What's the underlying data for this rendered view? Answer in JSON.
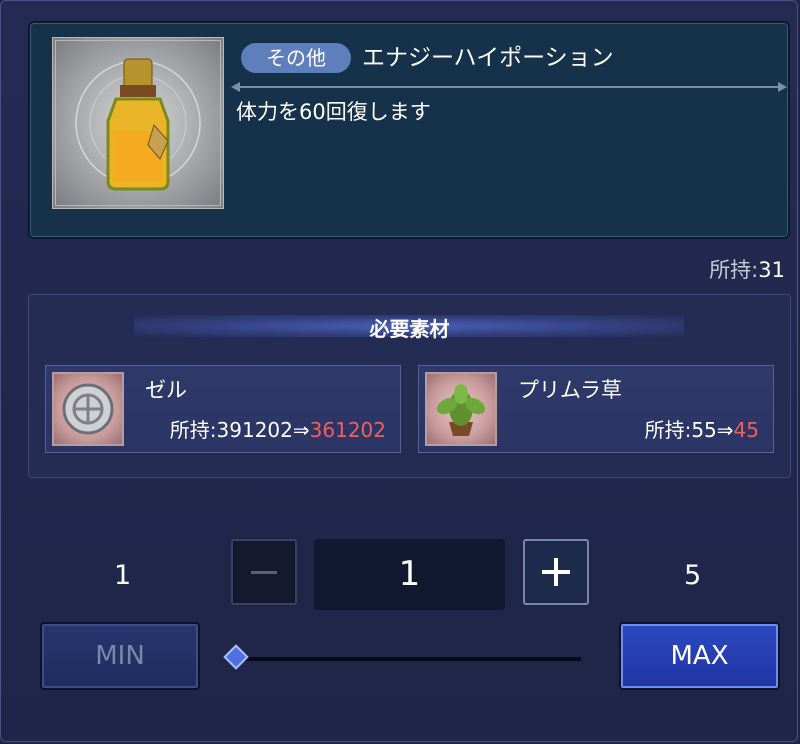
{
  "item": {
    "category": "その他",
    "name": "エナジーハイポーション",
    "description": "体力を60回復します",
    "icon": "potion-bottle-icon"
  },
  "owned": {
    "label": "所持:",
    "value": "31"
  },
  "materials": {
    "title": "必要素材",
    "items": [
      {
        "name": "ゼル",
        "label": "所持:",
        "before": "391202",
        "arrow": "⇒",
        "after": "361202",
        "icon": "zel-coin-icon"
      },
      {
        "name": "プリムラ草",
        "label": "所持:",
        "before": "55",
        "arrow": "⇒",
        "after": "45",
        "icon": "primula-herb-icon"
      }
    ]
  },
  "quantity": {
    "min_value": "1",
    "max_value": "5",
    "current": "1",
    "slider_fraction": 0.0
  },
  "buttons": {
    "min_label": "MIN",
    "max_label": "MAX"
  },
  "colors": {
    "accent": "#f0605e",
    "max_button": "#2d49c0"
  }
}
